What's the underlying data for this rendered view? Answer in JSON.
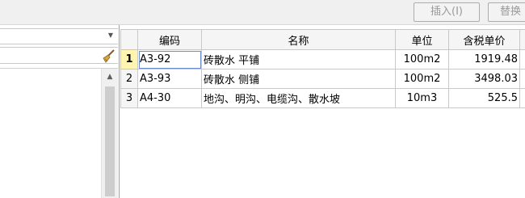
{
  "toolbar": {
    "insert_label": "插入(I)",
    "replace_label": "替换"
  },
  "table": {
    "headers": {
      "code": "编码",
      "name": "名称",
      "unit": "单位",
      "price": "含税单价"
    },
    "rows": [
      {
        "num": "1",
        "code": "A3-92",
        "name": "砖散水 平铺",
        "unit": "100m2",
        "price": "1919.48"
      },
      {
        "num": "2",
        "code": "A3-93",
        "name": "砖散水 侧铺",
        "unit": "100m2",
        "price": "3498.03"
      },
      {
        "num": "3",
        "code": "A4-30",
        "name": "地沟、明沟、电缆沟、散水坡",
        "unit": "10m3",
        "price": "525.5"
      }
    ]
  },
  "icons": {
    "combo": "chevron-down-icon",
    "clear": "broom-icon",
    "scroll_up": "arrow-up-icon"
  }
}
